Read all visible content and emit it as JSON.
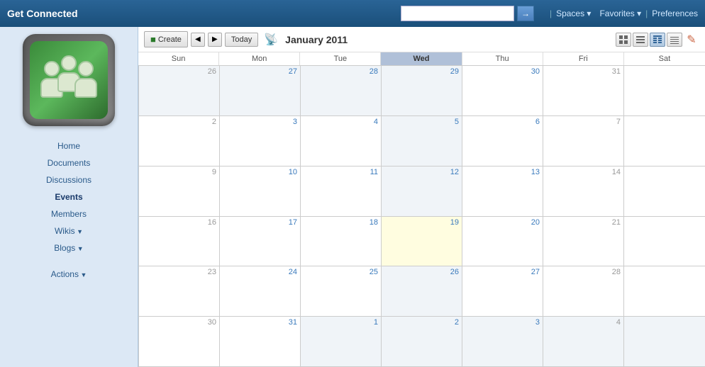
{
  "topbar": {
    "title": "Get Connected",
    "search_placeholder": "",
    "search_btn_icon": "→",
    "nav_sep1": "|",
    "spaces_label": "Spaces ▾",
    "nav_sep2": "Favorites ▾",
    "nav_sep3": "|",
    "preferences_label": "Preferences"
  },
  "sidebar": {
    "nav_items": [
      {
        "label": "Home",
        "active": false,
        "arrow": false
      },
      {
        "label": "Documents",
        "active": false,
        "arrow": false
      },
      {
        "label": "Discussions",
        "active": false,
        "arrow": false
      },
      {
        "label": "Events",
        "active": true,
        "arrow": false
      },
      {
        "label": "Members",
        "active": false,
        "arrow": false
      },
      {
        "label": "Wikis",
        "active": false,
        "arrow": true
      },
      {
        "label": "Blogs",
        "active": false,
        "arrow": true
      }
    ],
    "actions_label": "Actions",
    "actions_arrow": true
  },
  "calendar": {
    "toolbar": {
      "create_label": "Create",
      "prev_icon": "◀",
      "next_icon": "▶",
      "today_label": "Today",
      "rss_icon": "📡",
      "month_title": "January 2011"
    },
    "views": {
      "day": "▦",
      "week": "▤",
      "month": "▦",
      "agenda": "☰",
      "edit": "✎"
    },
    "day_headers": [
      "Sun",
      "Mon",
      "Tue",
      "Wed",
      "Thu",
      "Fri",
      "Sat"
    ],
    "today_col": 3,
    "weeks": [
      [
        {
          "num": "26",
          "type": "other",
          "blue": false
        },
        {
          "num": "27",
          "type": "other",
          "blue": true
        },
        {
          "num": "28",
          "type": "other",
          "blue": true
        },
        {
          "num": "29",
          "type": "today-col",
          "blue": true
        },
        {
          "num": "30",
          "type": "normal",
          "blue": true
        },
        {
          "num": "31",
          "type": "normal",
          "blue": false
        },
        {
          "num": "",
          "type": "normal",
          "blue": false
        }
      ],
      [
        {
          "num": "2",
          "type": "normal",
          "blue": false
        },
        {
          "num": "3",
          "type": "normal",
          "blue": true
        },
        {
          "num": "4",
          "type": "normal",
          "blue": true
        },
        {
          "num": "5",
          "type": "today-col",
          "blue": true
        },
        {
          "num": "6",
          "type": "normal",
          "blue": true
        },
        {
          "num": "7",
          "type": "normal",
          "blue": false
        },
        {
          "num": "",
          "type": "normal",
          "blue": false
        }
      ],
      [
        {
          "num": "9",
          "type": "normal",
          "blue": false
        },
        {
          "num": "10",
          "type": "normal",
          "blue": true
        },
        {
          "num": "11",
          "type": "normal",
          "blue": true
        },
        {
          "num": "12",
          "type": "today-col",
          "blue": true
        },
        {
          "num": "13",
          "type": "normal",
          "blue": true
        },
        {
          "num": "14",
          "type": "normal",
          "blue": false
        },
        {
          "num": "",
          "type": "normal",
          "blue": false
        }
      ],
      [
        {
          "num": "16",
          "type": "normal",
          "blue": false
        },
        {
          "num": "17",
          "type": "normal",
          "blue": true
        },
        {
          "num": "18",
          "type": "normal",
          "blue": true
        },
        {
          "num": "19",
          "type": "today-highlight",
          "blue": true
        },
        {
          "num": "20",
          "type": "normal",
          "blue": true
        },
        {
          "num": "21",
          "type": "normal",
          "blue": false
        },
        {
          "num": "",
          "type": "normal",
          "blue": false
        }
      ],
      [
        {
          "num": "23",
          "type": "normal",
          "blue": false
        },
        {
          "num": "24",
          "type": "normal",
          "blue": true
        },
        {
          "num": "25",
          "type": "normal",
          "blue": true
        },
        {
          "num": "26",
          "type": "today-col",
          "blue": true
        },
        {
          "num": "27",
          "type": "normal",
          "blue": true
        },
        {
          "num": "28",
          "type": "normal",
          "blue": false
        },
        {
          "num": "",
          "type": "normal",
          "blue": false
        }
      ],
      [
        {
          "num": "30",
          "type": "normal",
          "blue": false
        },
        {
          "num": "31",
          "type": "normal",
          "blue": true
        },
        {
          "num": "1",
          "type": "other",
          "blue": true
        },
        {
          "num": "2",
          "type": "other-today-col",
          "blue": true
        },
        {
          "num": "3",
          "type": "other",
          "blue": true
        },
        {
          "num": "4",
          "type": "other",
          "blue": false
        },
        {
          "num": "",
          "type": "other",
          "blue": false
        }
      ]
    ]
  }
}
